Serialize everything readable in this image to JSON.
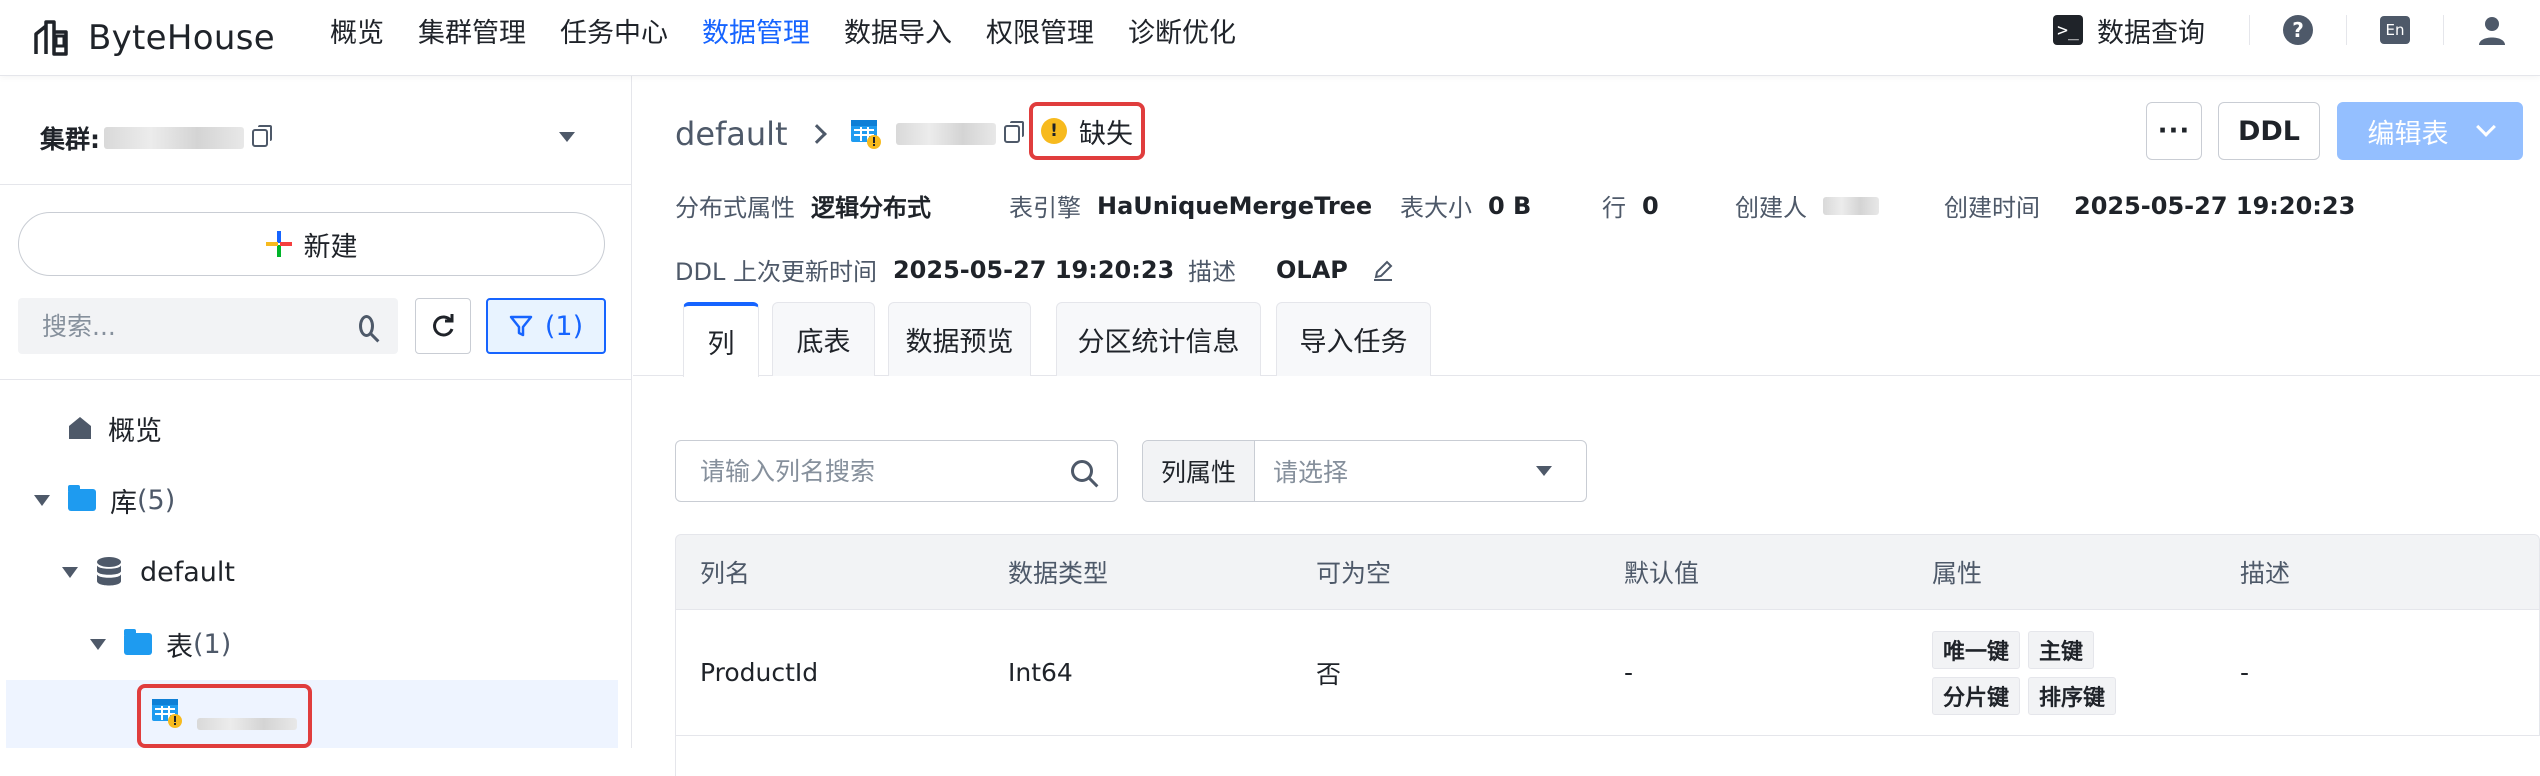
{
  "app": {
    "brand": "ByteHouse"
  },
  "nav": {
    "items": [
      "概览",
      "集群管理",
      "任务中心",
      "数据管理",
      "数据导入",
      "权限管理",
      "诊断优化"
    ],
    "active_index": 3
  },
  "topRight": {
    "query_label": "数据查询",
    "query_icon": ">_",
    "help_icon": "?",
    "lang_label": "En"
  },
  "sidebar": {
    "cluster_label": "集群:",
    "new_label": "新建",
    "search_placeholder": "搜索...",
    "filter_label": "(1)",
    "tree": {
      "overview": "概览",
      "libraries": "库",
      "libraries_count": "(5)",
      "db_name": "default",
      "tables": "表",
      "tables_count": "(1)"
    }
  },
  "header": {
    "breadcrumb_db": "default",
    "status_label": "缺失",
    "status_icon": "!",
    "more_label": "···",
    "ddl_label": "DDL",
    "edit_label": "编辑表"
  },
  "meta": {
    "distribution_key": "分布式属性",
    "distribution_value": "逻辑分布式",
    "engine_key": "表引擎",
    "engine_value": "HaUniqueMergeTree",
    "size_key": "表大小",
    "size_value": "0 B",
    "rows_key": "行",
    "rows_value": "0",
    "creator_key": "创建人",
    "created_key": "创建时间",
    "created_value": "2025-05-27 19:20:23",
    "ddl_updated_key": "DDL 上次更新时间",
    "ddl_updated_value": "2025-05-27 19:20:23",
    "desc_key": "描述",
    "desc_value": "OLAP"
  },
  "tabs": [
    "列",
    "底表",
    "数据预览",
    "分区统计信息",
    "导入任务"
  ],
  "filters": {
    "column_search_placeholder": "请输入列名搜索",
    "attr_label": "列属性",
    "attr_placeholder": "请选择"
  },
  "table": {
    "headers": [
      "列名",
      "数据类型",
      "可为空",
      "默认值",
      "属性",
      "描述"
    ],
    "rows": [
      {
        "name": "ProductId",
        "type": "Int64",
        "nullable": "否",
        "default": "-",
        "attrs": [
          "唯一键",
          "主键",
          "分片键",
          "排序键"
        ],
        "desc": "-"
      }
    ]
  },
  "colors": {
    "accent": "#1664ff",
    "highlight": "#e03d3d",
    "warning": "#f7ba1e",
    "disabled_primary": "#94bfff"
  }
}
